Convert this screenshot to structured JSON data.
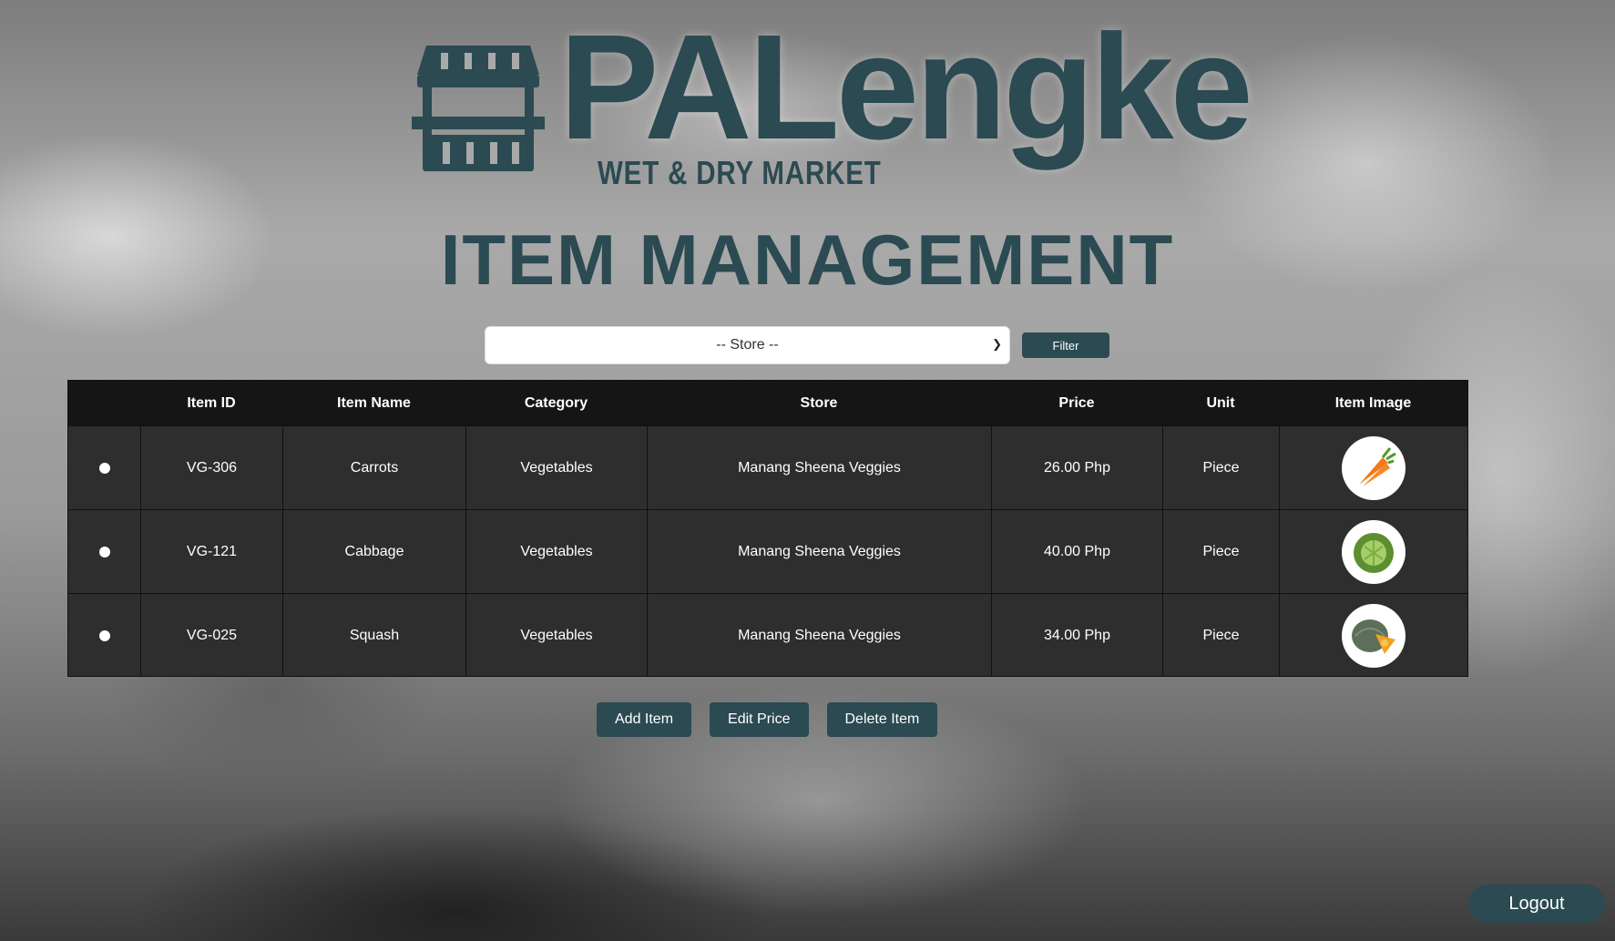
{
  "logo": {
    "main": "PALengke",
    "sub": "WET & DRY MARKET",
    "icon": "market-stall-icon"
  },
  "page_title": "ITEM MANAGEMENT",
  "filter": {
    "store_selected": "-- Store --",
    "filter_label": "Filter"
  },
  "table": {
    "headers": [
      "",
      "Item ID",
      "Item Name",
      "Category",
      "Store",
      "Price",
      "Unit",
      "Item Image"
    ],
    "rows": [
      {
        "id": "VG-306",
        "name": "Carrots",
        "category": "Vegetables",
        "store": "Manang Sheena Veggies",
        "price": "26.00 Php",
        "unit": "Piece",
        "image": "carrot-icon"
      },
      {
        "id": "VG-121",
        "name": "Cabbage",
        "category": "Vegetables",
        "store": "Manang Sheena Veggies",
        "price": "40.00 Php",
        "unit": "Piece",
        "image": "cabbage-icon"
      },
      {
        "id": "VG-025",
        "name": "Squash",
        "category": "Vegetables",
        "store": "Manang Sheena Veggies",
        "price": "34.00 Php",
        "unit": "Piece",
        "image": "squash-icon"
      }
    ]
  },
  "actions": {
    "add": "Add Item",
    "edit": "Edit Price",
    "delete": "Delete Item"
  },
  "logout": "Logout",
  "colors": {
    "brand": "#2b4a52",
    "table_bg": "#2e2e2e",
    "header_bg": "#151515"
  }
}
